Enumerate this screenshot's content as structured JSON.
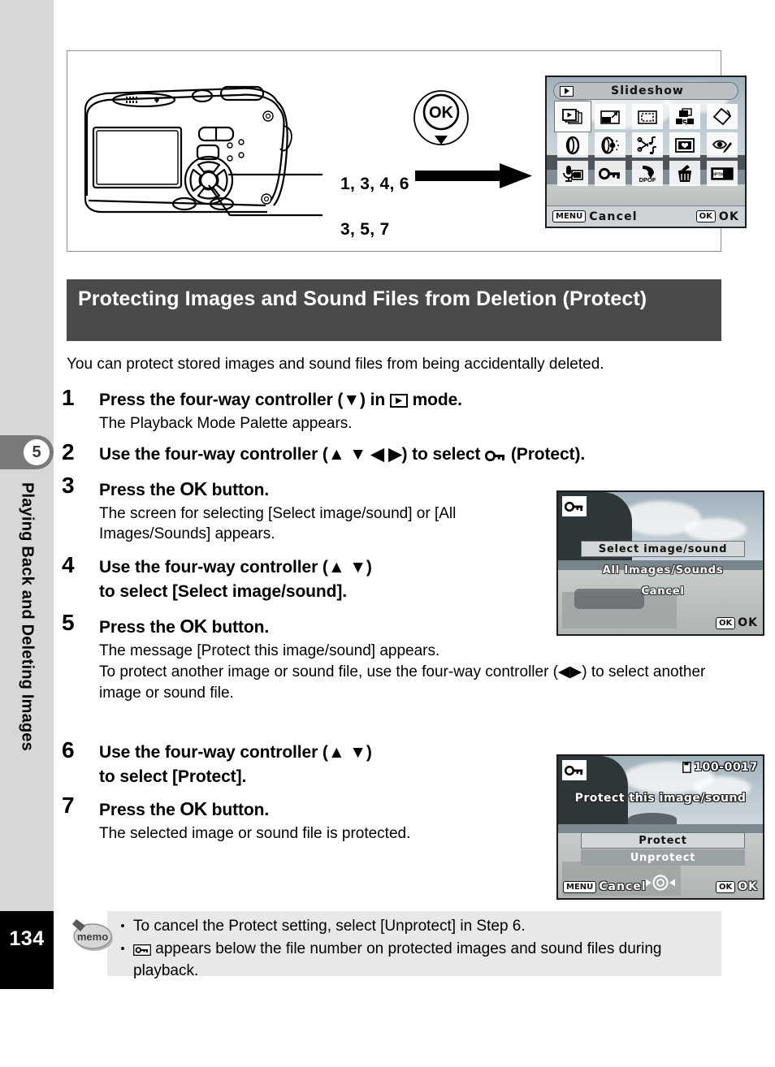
{
  "sidebar": {
    "chapter_number": "5",
    "chapter_title": "Playing Back and Deleting Images",
    "page_number": "134"
  },
  "figure": {
    "callout_top": "1, 3, 4, 6",
    "callout_bottom": "3, 5, 7",
    "ok_button_label": "OK"
  },
  "palette_screen": {
    "title": "Slideshow",
    "cancel_key": "MENU",
    "cancel_label": "Cancel",
    "ok_key": "OK",
    "ok_label": "OK",
    "icons": [
      "slideshow-icon",
      "resize-icon",
      "cropping-icon",
      "image-copy-icon",
      "image-rotation-icon",
      "digital-filter-icon",
      "brightness-filter-icon",
      "sound-editing-icon",
      "frame-composite-icon",
      "red-eye-compensation-icon",
      "voice-memo-icon",
      "protect-key-icon",
      "dpof-icon",
      "delete-trash-icon",
      "start-up-screen-icon"
    ],
    "selected_index": 0
  },
  "heading": {
    "title": "Protecting Images and Sound Files from Deletion (Protect)"
  },
  "intro": {
    "text": "You can protect stored images and sound files from being accidentally deleted."
  },
  "steps": [
    {
      "number": "1",
      "title_before": "Press the four-way controller (",
      "title_arrow": "▼",
      "title_middle": ") in ",
      "title_after": " mode.",
      "desc": "The Playback Mode Palette appears."
    },
    {
      "number": "2",
      "title_before": "Use the four-way controller (",
      "title_arrows": "▲ ▼ ◀ ▶",
      "title_after": ") to select ",
      "title_end": " (Protect)."
    },
    {
      "number": "3",
      "title_before": "Press the ",
      "title_ok": "OK",
      "title_after": " button.",
      "desc": "The screen for selecting [Select image/sound] or [All Images/Sounds] appears."
    },
    {
      "number": "4",
      "title_before": "Use the four-way controller (",
      "title_arrows": "▲ ▼",
      "title_after": ")",
      "title_line2": "to select [Select image/sound]."
    },
    {
      "number": "5",
      "title_before": "Press the ",
      "title_ok": "OK",
      "title_after": " button.",
      "desc1": "The message [Protect this image/sound] appears.",
      "desc2_before": "To protect another image or sound file, use the four-way controller (",
      "desc2_arrows": "◀▶",
      "desc2_after": ") to select another image or sound file."
    },
    {
      "number": "6",
      "title_before": "Use the four-way controller (",
      "title_arrows": "▲ ▼",
      "title_after": ")",
      "title_line2": "to select [Protect]."
    },
    {
      "number": "7",
      "title_before": "Press the ",
      "title_ok": "OK",
      "title_after": " button.",
      "desc": "The selected image or sound file is protected."
    }
  ],
  "select_screen": {
    "option_selected": "Select image/sound",
    "option_all": "All Images/Sounds",
    "option_cancel": "Cancel",
    "ok_key": "OK",
    "ok_label": "OK"
  },
  "protect_screen": {
    "file_number": "100-0017",
    "message": "Protect this image/sound",
    "option_protect": "Protect",
    "option_unprotect": "Unprotect",
    "menu_key": "MENU",
    "menu_label": "Cancel",
    "ok_key": "OK",
    "ok_label": "OK"
  },
  "memo": {
    "icon_label": "memo",
    "bullet": "•",
    "item1": "To cancel the Protect setting, select [Unprotect] in Step 6.",
    "item2_after": " appears below the file number on protected images and sound files during playback."
  },
  "colors": {
    "heading_bg": "#4a4a4a",
    "sidebar_bg": "#d7d7d7",
    "chapter_tab_bg": "#7a7a7a",
    "memo_bg": "#e8e8e8",
    "page_block_bg": "#000000"
  }
}
